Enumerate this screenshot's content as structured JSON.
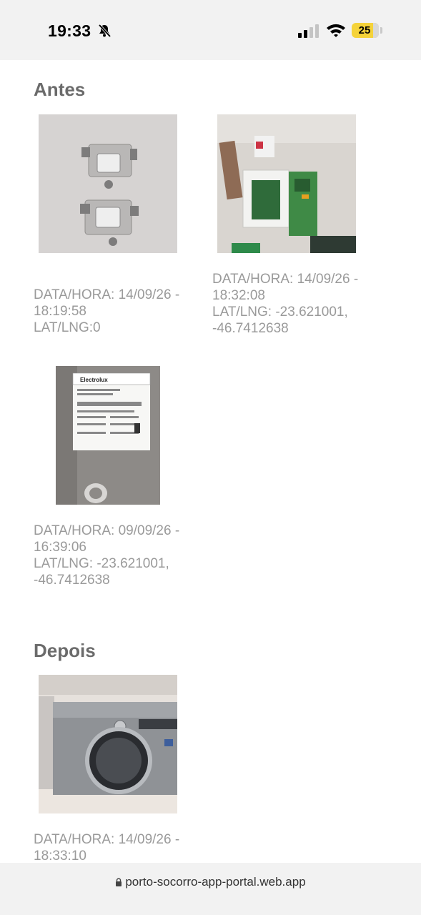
{
  "status_bar": {
    "time": "19:33",
    "battery": "25"
  },
  "sections": {
    "before": {
      "title": "Antes"
    },
    "after": {
      "title": "Depois"
    }
  },
  "photos": [
    {
      "datetime": "DATA/HORA: 14/09/26 -",
      "datetime2": "18:19:58",
      "latlng": "LAT/LNG:0",
      "latlng2": ""
    },
    {
      "datetime": "DATA/HORA: 14/09/26 -",
      "datetime2": "18:32:08",
      "latlng": "LAT/LNG:  -23.621001,",
      "latlng2": "-46.7412638"
    },
    {
      "datetime": "DATA/HORA: 09/09/26 -",
      "datetime2": "16:39:06",
      "latlng": "LAT/LNG:  -23.621001,",
      "latlng2": "-46.7412638"
    },
    {
      "datetime": "DATA/HORA: 14/09/26 -",
      "datetime2": "18:33:10",
      "latlng": "",
      "latlng2": ""
    }
  ],
  "label_text": {
    "brand": "Electrolux"
  },
  "address_bar": {
    "url": "porto-socorro-app-portal.web.app"
  }
}
